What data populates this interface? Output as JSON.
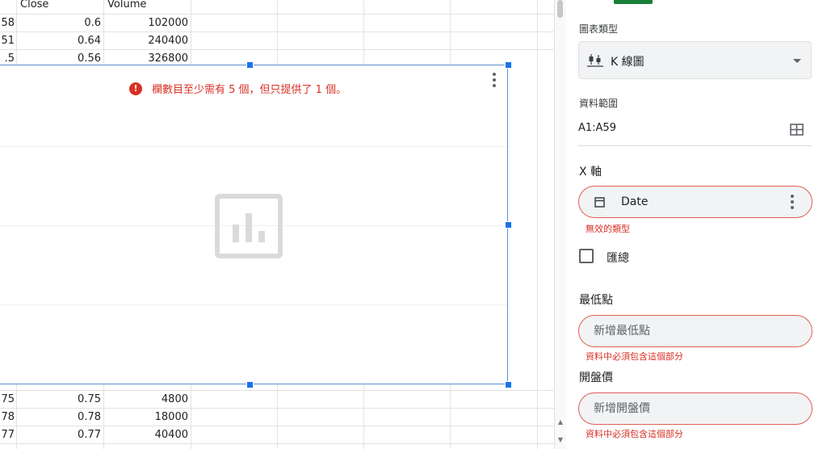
{
  "sheet": {
    "headers": {
      "close": "Close",
      "volume": "Volume"
    },
    "rows_top": [
      {
        "a": "58",
        "close": "0.6",
        "volume": "102000"
      },
      {
        "a": "51",
        "close": "0.64",
        "volume": "240400"
      },
      {
        "a": ".5",
        "close": "0.56",
        "volume": "326800"
      }
    ],
    "rows_bottom": [
      {
        "a": "75",
        "close": "0.75",
        "volume": "4800"
      },
      {
        "a": "78",
        "close": "0.78",
        "volume": "18000"
      },
      {
        "a": "77",
        "close": "0.77",
        "volume": "40400"
      }
    ]
  },
  "chart": {
    "error_message": "欄數目至少需有 5 個，但只提供了 1 個。",
    "error_icon": "!",
    "placeholder_icon": "bar-chart-placeholder-icon"
  },
  "panel": {
    "chart_type_label": "圖表類型",
    "chart_type_value": "K 線圖",
    "data_range_label": "資料範圍",
    "data_range_value": "A1:A59",
    "x_axis_label": "X 軸",
    "x_axis_value": "Date",
    "x_axis_error": "無效的類型",
    "aggregate_label": "匯總",
    "low_label": "最低點",
    "low_placeholder": "新增最低點",
    "low_error": "資料中必須包含這個部分",
    "open_label": "開盤價",
    "open_placeholder": "新增開盤價",
    "open_error": "資料中必須包含這個部分"
  },
  "colors": {
    "error": "#d93025",
    "accent": "#188038",
    "selection": "#1a73e8"
  }
}
